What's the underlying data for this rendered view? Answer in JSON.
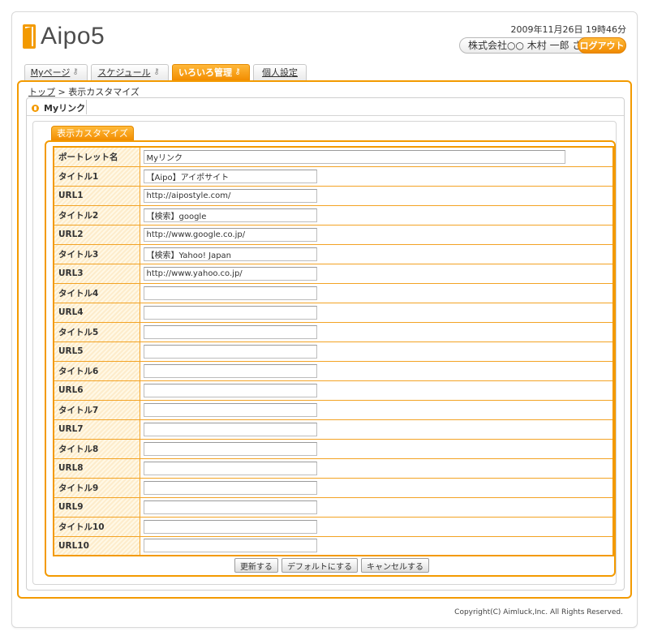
{
  "header": {
    "logo_text": "Aipo5",
    "datetime": "2009年11月26日 19時46分",
    "user": "株式会社○○ 木村 一郎 さま",
    "logout_label": "ログアウト"
  },
  "tabs": [
    {
      "label": "Myページ",
      "active": false
    },
    {
      "label": "スケジュール",
      "active": false
    },
    {
      "label": "いろいろ管理",
      "active": true
    },
    {
      "label": "個人設定",
      "active": false
    }
  ],
  "breadcrumb": {
    "top": "トップ",
    "separator": ">",
    "current": "表示カスタマイズ"
  },
  "portlet": {
    "title": "Myリンク"
  },
  "section_tab": "表示カスタマイズ",
  "form": {
    "rows": [
      {
        "label": "ポートレット名",
        "value": "Myリンク"
      },
      {
        "label": "タイトル1",
        "value": "【Aipo】アイポサイト"
      },
      {
        "label": "URL1",
        "value": "http://aipostyle.com/"
      },
      {
        "label": "タイトル2",
        "value": "【検索】google"
      },
      {
        "label": "URL2",
        "value": "http://www.google.co.jp/"
      },
      {
        "label": "タイトル3",
        "value": "【検索】Yahoo! Japan"
      },
      {
        "label": "URL3",
        "value": "http://www.yahoo.co.jp/"
      },
      {
        "label": "タイトル4",
        "value": ""
      },
      {
        "label": "URL4",
        "value": ""
      },
      {
        "label": "タイトル5",
        "value": ""
      },
      {
        "label": "URL5",
        "value": ""
      },
      {
        "label": "タイトル6",
        "value": ""
      },
      {
        "label": "URL6",
        "value": ""
      },
      {
        "label": "タイトル7",
        "value": ""
      },
      {
        "label": "URL7",
        "value": ""
      },
      {
        "label": "タイトル8",
        "value": ""
      },
      {
        "label": "URL8",
        "value": ""
      },
      {
        "label": "タイトル9",
        "value": ""
      },
      {
        "label": "URL9",
        "value": ""
      },
      {
        "label": "タイトル10",
        "value": ""
      },
      {
        "label": "URL10",
        "value": ""
      }
    ],
    "buttons": {
      "update": "更新する",
      "default": "デフォルトにする",
      "cancel": "キャンセルする"
    }
  },
  "footer": {
    "copyright": "Copyright(C) Aimluck,Inc. All Rights Reserved."
  },
  "colors": {
    "accent": "#f39a00",
    "label_bg": "#fdeccb"
  },
  "icons": [
    "door-logo-icon",
    "key-icon",
    "portlet-bullet-icon"
  ]
}
